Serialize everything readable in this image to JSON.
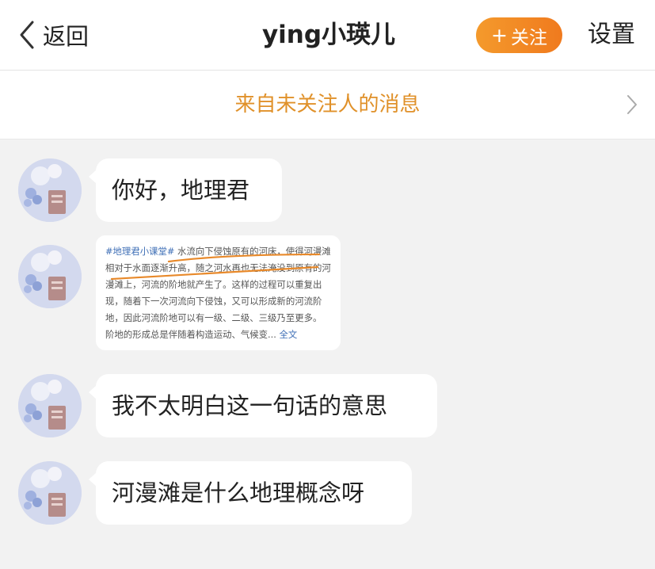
{
  "header": {
    "back_label": "返回",
    "title": "ying小瑛儿",
    "follow_plus": "+",
    "follow_label": "关注",
    "settings_label": "设置"
  },
  "notice": {
    "text": "来自未关注人的消息"
  },
  "messages": [
    {
      "type": "text",
      "text": "你好，地理君"
    },
    {
      "type": "image",
      "tag": "#地理君小课堂#",
      "body": " 水流向下侵蚀原有的河床，使得河漫滩相对于水面逐渐升高，随之河水再也无法淹没到原有的河漫滩上，河流的阶地就产生了。这样的过程可以重复出现，随着下一次河流向下侵蚀，又可以形成新的河流阶地，因此河流阶地可以有一级、二级、三级乃至更多。",
      "tail": "阶地的形成总是伴随着构造运动、气候变...",
      "more": "全文"
    },
    {
      "type": "text",
      "text": "我不太明白这一句话的意思"
    },
    {
      "type": "text",
      "text": "河漫滩是什么地理概念呀"
    }
  ],
  "colors": {
    "accent": "#f49a2c",
    "notice_text": "#e0912a",
    "underline": "#e8892a",
    "link": "#3f6fb6"
  }
}
